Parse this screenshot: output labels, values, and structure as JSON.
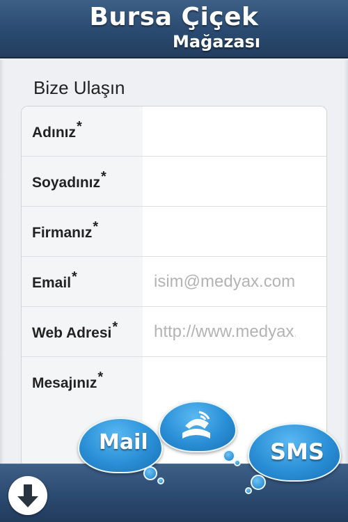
{
  "header": {
    "brand_line1": "Bursa Çiçek",
    "brand_line2": "Mağazası"
  },
  "form": {
    "title": "Bize Ulaşın",
    "required_mark": "*",
    "fields": [
      {
        "label": "Adınız",
        "placeholder": "",
        "value": ""
      },
      {
        "label": "Soyadınız",
        "placeholder": "",
        "value": ""
      },
      {
        "label": "Firmanız",
        "placeholder": "",
        "value": ""
      },
      {
        "label": "Email",
        "placeholder": "isim@medyax.com",
        "value": ""
      },
      {
        "label": "Web Adresi",
        "placeholder": "http://www.medyax.com",
        "value": ""
      },
      {
        "label": "Mesajınız",
        "placeholder": "",
        "value": ""
      }
    ]
  },
  "contact_clouds": {
    "mail": "Mail",
    "phone_icon": "phone-icon",
    "sms": "SMS"
  },
  "toolbar": {
    "download_icon": "arrow-down-icon"
  },
  "colors": {
    "header_bar": "#2a4a70",
    "cloud_blue": "#2a8fd6"
  }
}
